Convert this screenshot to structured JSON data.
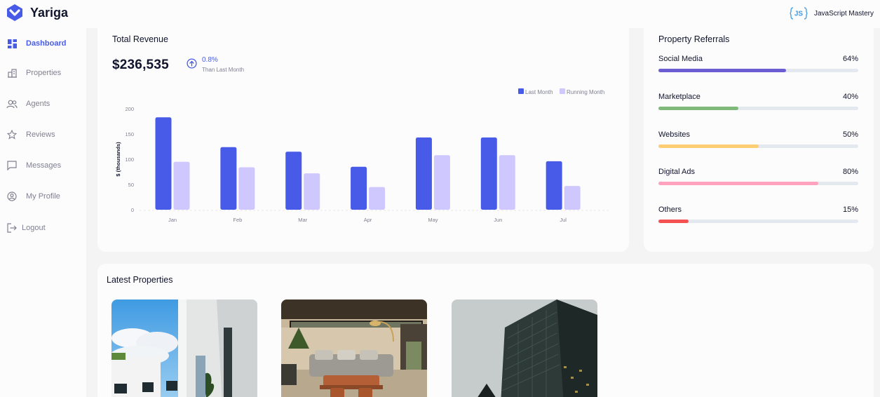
{
  "app": {
    "name": "Yariga"
  },
  "sidebar": {
    "items": [
      {
        "label": "Dashboard",
        "icon": "dashboard-icon",
        "active": true
      },
      {
        "label": "Properties",
        "icon": "properties-icon"
      },
      {
        "label": "Agents",
        "icon": "agents-icon"
      },
      {
        "label": "Reviews",
        "icon": "star-icon"
      },
      {
        "label": "Messages",
        "icon": "message-icon"
      },
      {
        "label": "My Profile",
        "icon": "profile-icon"
      },
      {
        "label": "Logout",
        "icon": "logout-icon"
      }
    ]
  },
  "header": {
    "user_name": "JavaScript Mastery",
    "avatar_text": "JS"
  },
  "revenue": {
    "title": "Total Revenue",
    "amount": "$236,535",
    "change": "0.8%",
    "change_caption": "Than Last Month"
  },
  "chart_data": {
    "type": "bar",
    "categories": [
      "Jan",
      "Feb",
      "Mar",
      "Apr",
      "May",
      "Jun",
      "Jul"
    ],
    "series": [
      {
        "name": "Last Month",
        "color": "#475be8",
        "values": [
          183,
          124,
          115,
          85,
          143,
          143,
          96
        ]
      },
      {
        "name": "Running Month",
        "color": "#cfc8ff",
        "values": [
          95,
          84,
          72,
          45,
          108,
          108,
          47
        ]
      }
    ],
    "ylabel": "$ (thousands)",
    "yticks": [
      0,
      50,
      100,
      150,
      200
    ],
    "ylim": [
      0,
      200
    ],
    "legend": "top-right"
  },
  "referrals": {
    "title": "Property Referrals",
    "items": [
      {
        "name": "Social Media",
        "percent_label": "64%",
        "value": 64,
        "color": "#6c5dd3"
      },
      {
        "name": "Marketplace",
        "percent_label": "40%",
        "value": 40,
        "color": "#7fba7a"
      },
      {
        "name": "Websites",
        "percent_label": "50%",
        "value": 50,
        "color": "#ffce73"
      },
      {
        "name": "Digital Ads",
        "percent_label": "80%",
        "value": 80,
        "color": "#ffa2c0"
      },
      {
        "name": "Others",
        "percent_label": "15%",
        "value": 15,
        "color": "#f45252"
      }
    ]
  },
  "latest": {
    "title": "Latest Properties",
    "images": [
      "white-apartment-building",
      "living-room-interior",
      "glass-skyscraper"
    ]
  }
}
